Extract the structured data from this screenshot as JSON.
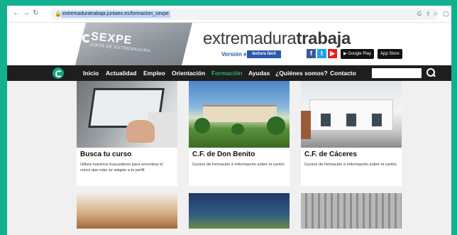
{
  "browser": {
    "url": "extremaduratrabaja.juntaex.es/formacion_sexpe",
    "back_icon": "back-arrow-icon",
    "forward_icon": "forward-arrow-icon",
    "reload_icon": "reload-icon",
    "lock_icon": "lock-icon"
  },
  "header": {
    "logo_text": "SEXPE",
    "logo_sub": "JUNTA DE EXTREMADURA",
    "site_title_light": "extremadura",
    "site_title_bold": "trabaja",
    "version_label": "Versión en",
    "lectura_label": "lectura fácil",
    "google_play_label": "Google Play",
    "app_store_label": "App Store"
  },
  "nav": {
    "items": [
      "Inicio",
      "Actualidad",
      "Empleo",
      "Orientación",
      "Formación",
      "Ayudas",
      "¿Quiénes somos?",
      "Contacto"
    ],
    "active": "Formación"
  },
  "cards": [
    {
      "title": "Busca tu curso",
      "desc": "Utiliza nuestros buscadores para encontrar el curso que más se adapte a tu perfil"
    },
    {
      "title": "C.F. de Don Benito",
      "desc": "Cursos de formación e información sobre el centro"
    },
    {
      "title": "C.F. de Cáceres",
      "desc": "Cursos de formación e información sobre el centro"
    }
  ],
  "colors": {
    "accent": "#12b08e",
    "nav_bg": "#1e1e1e",
    "nav_active": "#27b46b",
    "facebook": "#3b5998",
    "twitter": "#1da1f2",
    "youtube": "#e62117"
  }
}
